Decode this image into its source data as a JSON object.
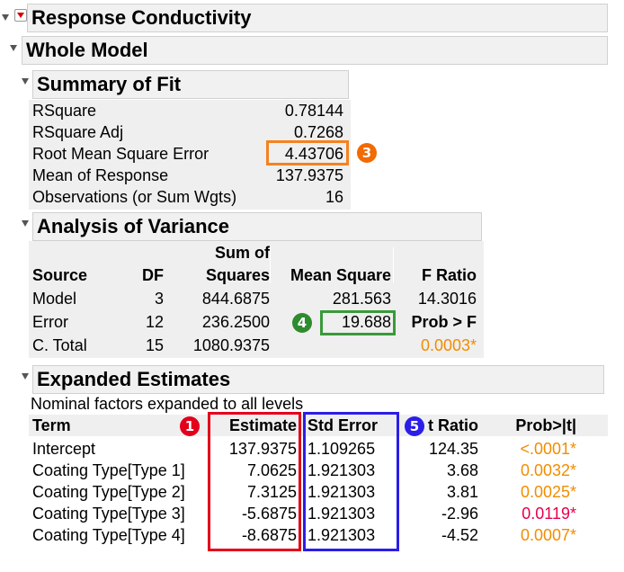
{
  "response": {
    "title": "Response Conductivity"
  },
  "whole_model": {
    "title": "Whole Model"
  },
  "summary_of_fit": {
    "title": "Summary of Fit",
    "rows": [
      {
        "label": "RSquare",
        "value": "0.78144"
      },
      {
        "label": "RSquare Adj",
        "value": "0.7268"
      },
      {
        "label": "Root Mean Square Error",
        "value": "4.43706"
      },
      {
        "label": "Mean of Response",
        "value": "137.9375"
      },
      {
        "label": "Observations (or Sum Wgts)",
        "value": "16"
      }
    ]
  },
  "anova": {
    "title": "Analysis of Variance",
    "headers": {
      "source": "Source",
      "df": "DF",
      "ss_line1": "Sum of",
      "ss_line2": "Squares",
      "ms": "Mean Square",
      "f_ratio": "F Ratio",
      "prob_f": "Prob > F"
    },
    "rows": [
      {
        "source": "Model",
        "df": "3",
        "ss": "844.6875",
        "ms": "281.563",
        "f": "14.3016"
      },
      {
        "source": "Error",
        "df": "12",
        "ss": "236.2500",
        "ms": "19.688",
        "f": "Prob > F"
      },
      {
        "source": "C. Total",
        "df": "15",
        "ss": "1080.9375",
        "ms": "",
        "f": "0.0003*"
      }
    ]
  },
  "expanded_estimates": {
    "title": "Expanded Estimates",
    "note": "Nominal factors expanded to all levels",
    "headers": {
      "term": "Term",
      "estimate": "Estimate",
      "std_error": "Std Error",
      "t_ratio": "t Ratio",
      "prob": "Prob>|t|"
    },
    "rows": [
      {
        "term": "Intercept",
        "estimate": "137.9375",
        "std_error": "1.109265",
        "t_ratio": "124.35",
        "prob": "<.0001*"
      },
      {
        "term": "Coating Type[Type 1]",
        "estimate": "7.0625",
        "std_error": "1.921303",
        "t_ratio": "3.68",
        "prob": "0.0032*"
      },
      {
        "term": "Coating Type[Type 2]",
        "estimate": "7.3125",
        "std_error": "1.921303",
        "t_ratio": "3.81",
        "prob": "0.0025*"
      },
      {
        "term": "Coating Type[Type 3]",
        "estimate": "-5.6875",
        "std_error": "1.921303",
        "t_ratio": "-2.96",
        "prob": "0.0119*"
      },
      {
        "term": "Coating Type[Type 4]",
        "estimate": "-8.6875",
        "std_error": "1.921303",
        "t_ratio": "-4.52",
        "prob": "0.0007*"
      }
    ]
  },
  "annotations": {
    "badge_1": "❶",
    "badge_3": "❸",
    "badge_4": "❹",
    "badge_5": "❺"
  },
  "colors": {
    "prob_orange": "#f28c00",
    "prob_red": "#e6004c",
    "box_orange": "#f58220",
    "box_green": "#3a9a3a",
    "box_red": "#e3001b",
    "box_blue": "#2a1ee8",
    "badge_red": "#e3001b",
    "badge_orange": "#f26a00",
    "badge_green": "#2e8b2e",
    "badge_blue": "#2a1ee8"
  }
}
